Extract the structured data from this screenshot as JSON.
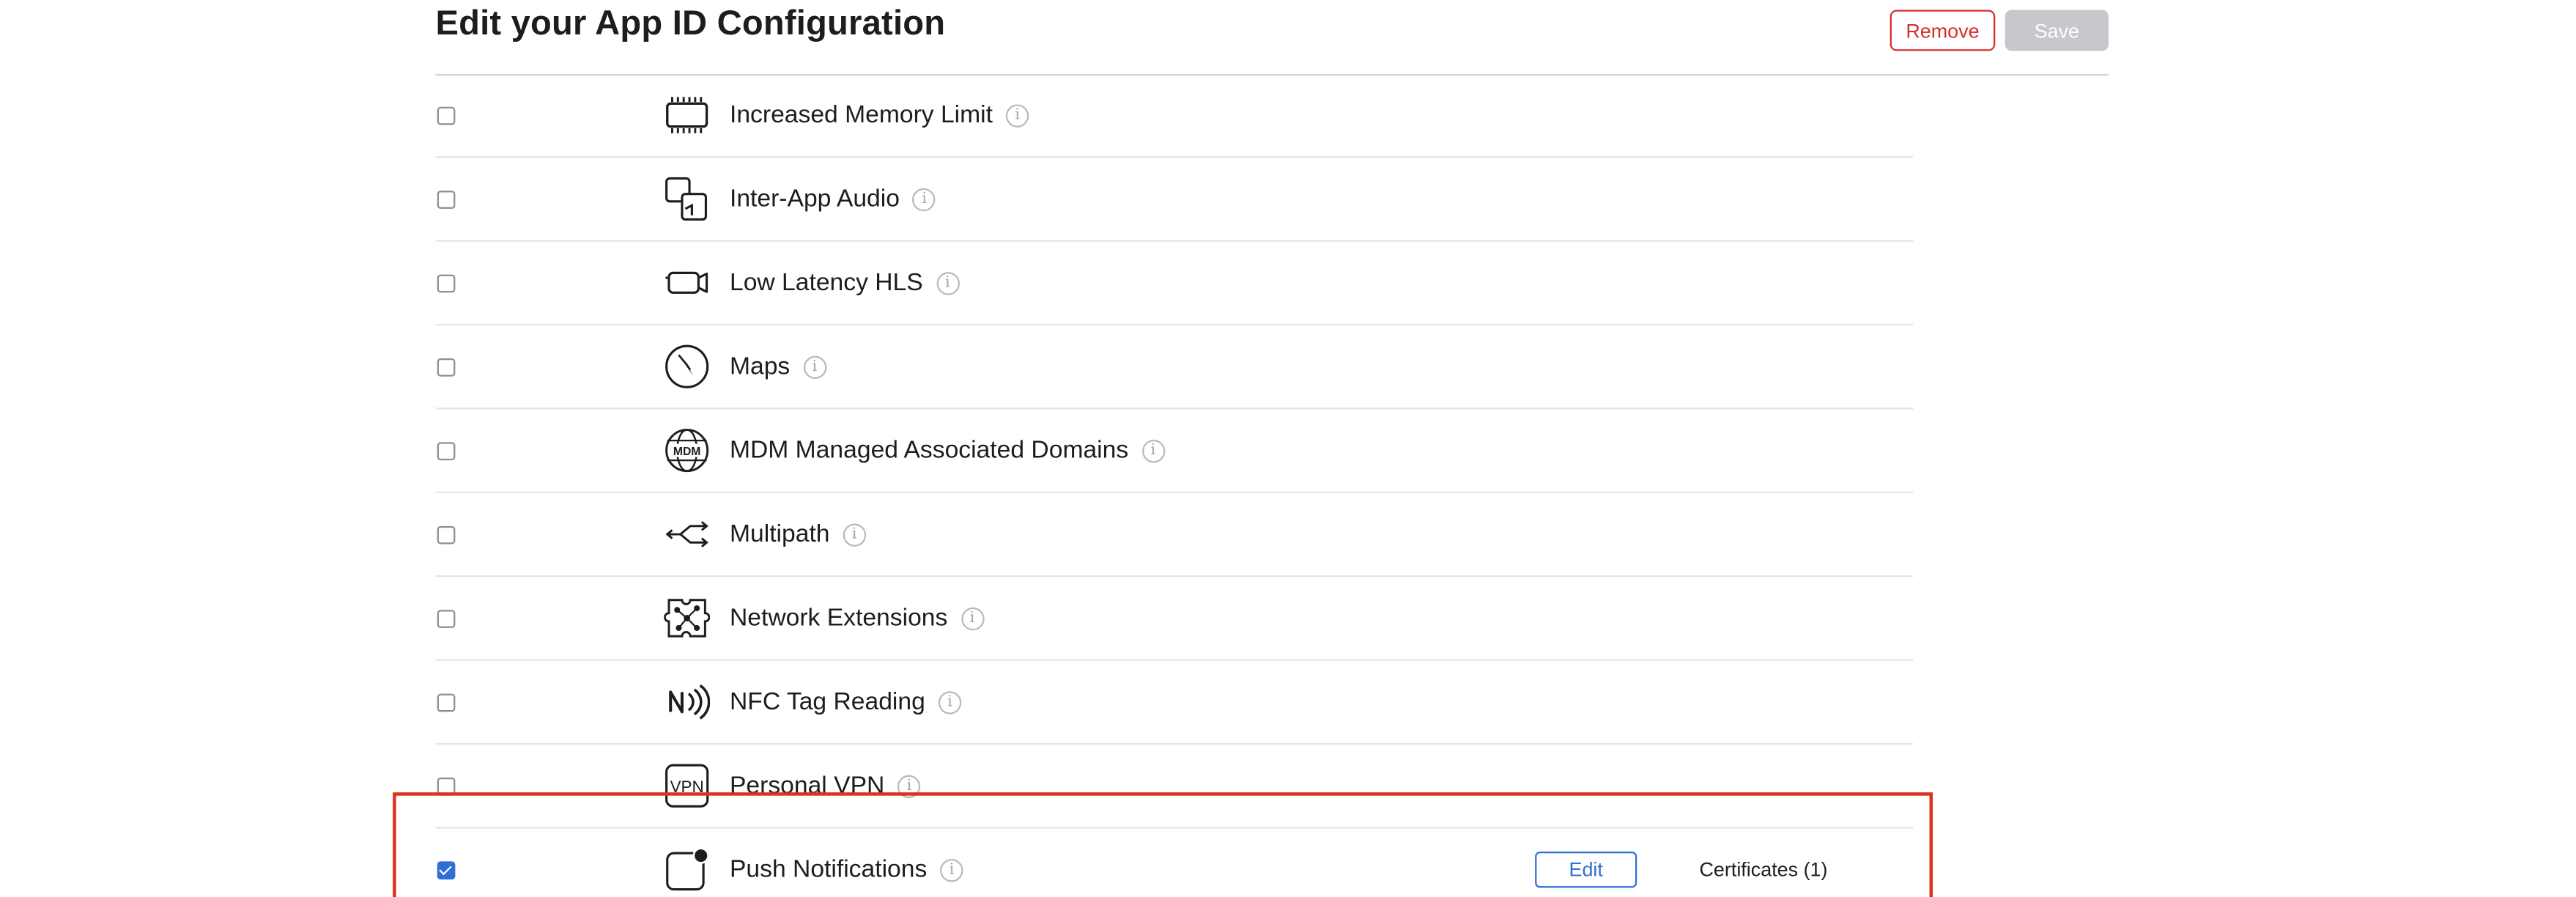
{
  "header": {
    "title": "Edit your App ID Configuration",
    "remove_label": "Remove",
    "save_label": "Save"
  },
  "capabilities": [
    {
      "label": "Increased Memory Limit",
      "icon": "memory-chip-icon",
      "checked": false
    },
    {
      "label": "Inter-App Audio",
      "icon": "inter-app-audio-icon",
      "checked": false
    },
    {
      "label": "Low Latency HLS",
      "icon": "video-camera-icon",
      "checked": false
    },
    {
      "label": "Maps",
      "icon": "compass-icon",
      "checked": false
    },
    {
      "label": "MDM Managed Associated Domains",
      "icon": "mdm-globe-icon",
      "checked": false
    },
    {
      "label": "Multipath",
      "icon": "multipath-arrows-icon",
      "checked": false
    },
    {
      "label": "Network Extensions",
      "icon": "network-extensions-icon",
      "checked": false
    },
    {
      "label": "NFC Tag Reading",
      "icon": "nfc-icon",
      "checked": false
    },
    {
      "label": "Personal VPN",
      "icon": "vpn-icon",
      "checked": false
    },
    {
      "label": "Push Notifications",
      "icon": "push-notification-icon",
      "checked": true,
      "edit_label": "Edit",
      "certificates_label": "Certificates (1)"
    }
  ],
  "icons": {
    "info_glyph": "i",
    "vpn_text": "VPN",
    "mdm_text": "MDM"
  },
  "colors": {
    "accent": "#2f6fd6",
    "destructive": "#d52c2c",
    "highlight": "#e0311f",
    "disabled": "#c7c7cc"
  }
}
